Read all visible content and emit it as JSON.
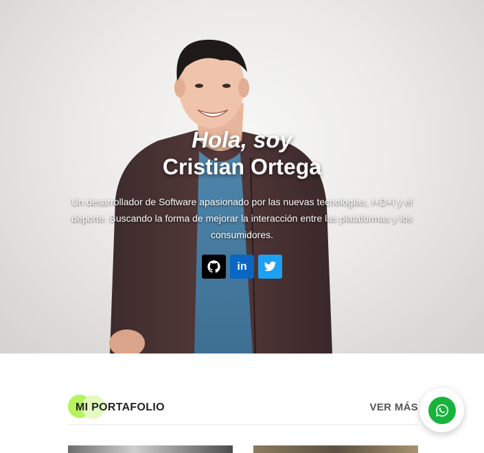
{
  "hero": {
    "greeting": "Hola, soy",
    "name": "Cristian Ortega",
    "description": "Un desarrollador de Software apasionado por las nuevas tecnologías, I+D+I y el deporte. Buscando la forma de mejorar la interacción entre las plataformas y los consumidores."
  },
  "socials": [
    {
      "icon": "github-icon",
      "color": "#000000"
    },
    {
      "icon": "linkedin-icon",
      "label": "in",
      "color": "#0a66c2"
    },
    {
      "icon": "twitter-icon",
      "color": "#1da1f2"
    }
  ],
  "portfolio": {
    "title": "MI PORTAFOLIO",
    "see_more": "VER MÁS",
    "accent": "#b7f35c"
  },
  "whatsapp": {
    "icon": "whatsapp-icon",
    "color": "#17b33c"
  }
}
